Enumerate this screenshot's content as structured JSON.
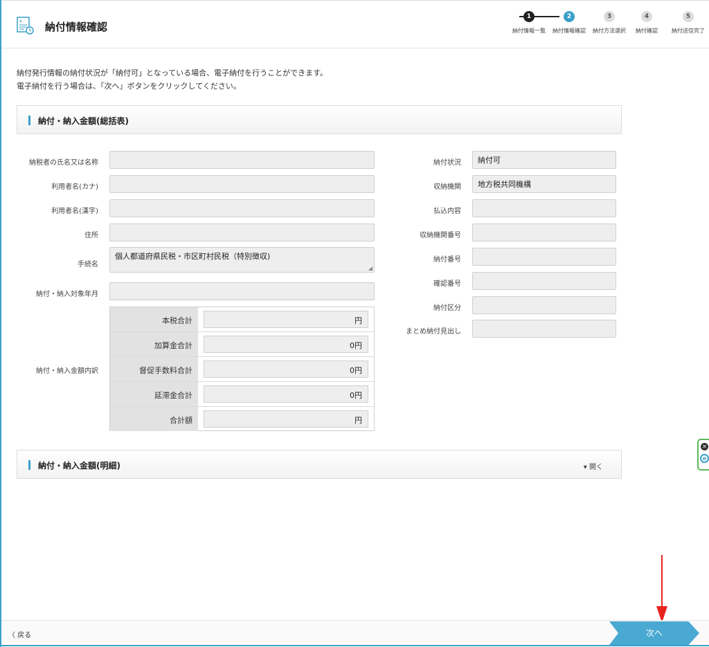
{
  "header": {
    "title": "納付情報確認",
    "steps": [
      {
        "number": "1",
        "label": "納付情報一覧",
        "state": "done"
      },
      {
        "number": "2",
        "label": "納付情報確認",
        "state": "active"
      },
      {
        "number": "3",
        "label": "納付方法選択",
        "state": "pending"
      },
      {
        "number": "4",
        "label": "納付確認",
        "state": "pending"
      },
      {
        "number": "5",
        "label": "納付送信完了",
        "state": "pending"
      }
    ]
  },
  "intro": {
    "line1": "納付発行情報の納付状況が「納付可」となっている場合、電子納付を行うことができます。",
    "line2": "電子納付を行う場合は、「次へ」ボタンをクリックしてください。"
  },
  "summary_panel": {
    "title": "納付・納入金額(総括表)",
    "left_fields": [
      {
        "label": "納税者の氏名又は名称",
        "value": ""
      },
      {
        "label": "利用者名(カナ)",
        "value": ""
      },
      {
        "label": "利用者名(漢字)",
        "value": ""
      },
      {
        "label": "住所",
        "value": ""
      },
      {
        "label": "手続名",
        "value": "個人都道府県民税・市区町村民税（特別徴収)"
      },
      {
        "label": "納付・納入対象年月",
        "value": ""
      }
    ],
    "amount_breakdown": {
      "label": "納付・納入金額内訳",
      "rows": [
        {
          "name": "本税合計",
          "value": "円"
        },
        {
          "name": "加算金合計",
          "value": "0円"
        },
        {
          "name": "督促手数料合計",
          "value": "0円"
        },
        {
          "name": "延滞金合計",
          "value": "0円"
        },
        {
          "name": "合計額",
          "value": "円"
        }
      ]
    },
    "right_fields": [
      {
        "label": "納付状況",
        "value": "納付可"
      },
      {
        "label": "収納機関",
        "value": "地方税共同機構"
      },
      {
        "label": "払込内容",
        "value": ""
      },
      {
        "label": "収納機関番号",
        "value": ""
      },
      {
        "label": "納付番号",
        "value": ""
      },
      {
        "label": "確認番号",
        "value": ""
      },
      {
        "label": "納付区分",
        "value": ""
      },
      {
        "label": "まとめ納付見出し",
        "value": ""
      }
    ]
  },
  "detail_panel": {
    "title": "納付・納入金額(明細)",
    "toggle_label": "▾ 開く"
  },
  "footer": {
    "back_label": "〈 戻る",
    "next_label": "次へ"
  },
  "colors": {
    "accent": "#3aa0c9",
    "next_button": "#4aa9d2",
    "annotation_arrow": "#e8231e"
  }
}
